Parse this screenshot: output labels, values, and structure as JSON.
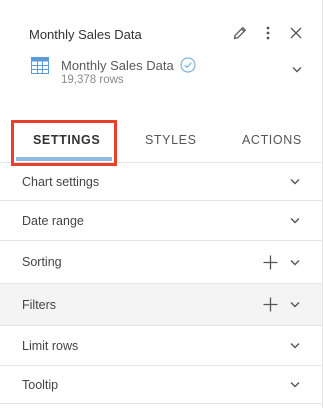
{
  "header": {
    "title": "Monthly Sales Data",
    "icons": [
      "pencil-icon",
      "more-vertical-icon",
      "close-icon"
    ]
  },
  "datasource": {
    "name": "Monthly Sales Data",
    "rows": "19,378 rows",
    "icon": "table-icon",
    "status_icon": "verified-check-icon"
  },
  "tabs": [
    {
      "label": "SETTINGS",
      "active": true
    },
    {
      "label": "STYLES",
      "active": false
    },
    {
      "label": "ACTIONS",
      "active": false
    }
  ],
  "sections": [
    {
      "label": "Chart settings",
      "has_add": false
    },
    {
      "label": "Date range",
      "has_add": false
    },
    {
      "label": "Sorting",
      "has_add": true
    },
    {
      "label": "Filters",
      "has_add": true,
      "hovered": true
    },
    {
      "label": "Limit rows",
      "has_add": false
    },
    {
      "label": "Tooltip",
      "has_add": false
    }
  ],
  "colors": {
    "accent": "#8dbbe2",
    "highlight": "#e9402b",
    "table_icon": "#5b9bd5",
    "check": "#7fb5e0"
  }
}
